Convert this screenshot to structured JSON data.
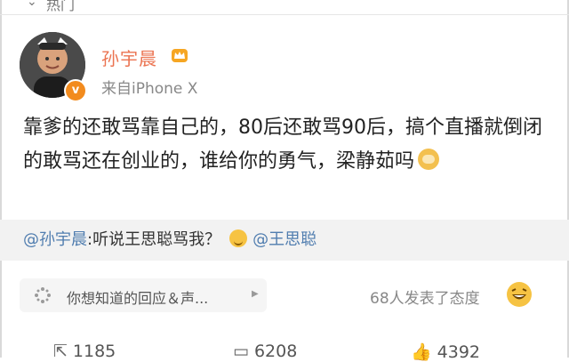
{
  "top_bar": {
    "label": "热门"
  },
  "author": {
    "name": "孙宇晨",
    "source": "来自iPhone X",
    "verified_badge": "v"
  },
  "post": {
    "text": "靠爹的还敢骂靠自己的，80后还敢骂90后，搞个直播就倒闭的敢骂还在创业的，谁给你的勇气，梁静茹吗",
    "emoji": "doge"
  },
  "quote": {
    "mention": "@孙宇晨",
    "text": ":听说王思聪骂我？",
    "emoji": "smile",
    "mention2": "@王思聪"
  },
  "reply_bar": {
    "placeholder": "你想知道的回应＆声...",
    "attitude_text": "68人发表了态度"
  },
  "actions": {
    "repost_count": "1185",
    "comment_count": "6208",
    "like_count": "4392"
  },
  "colors": {
    "username": "#eb7350",
    "mention": "#507daf",
    "badge": "#f28b1e"
  }
}
